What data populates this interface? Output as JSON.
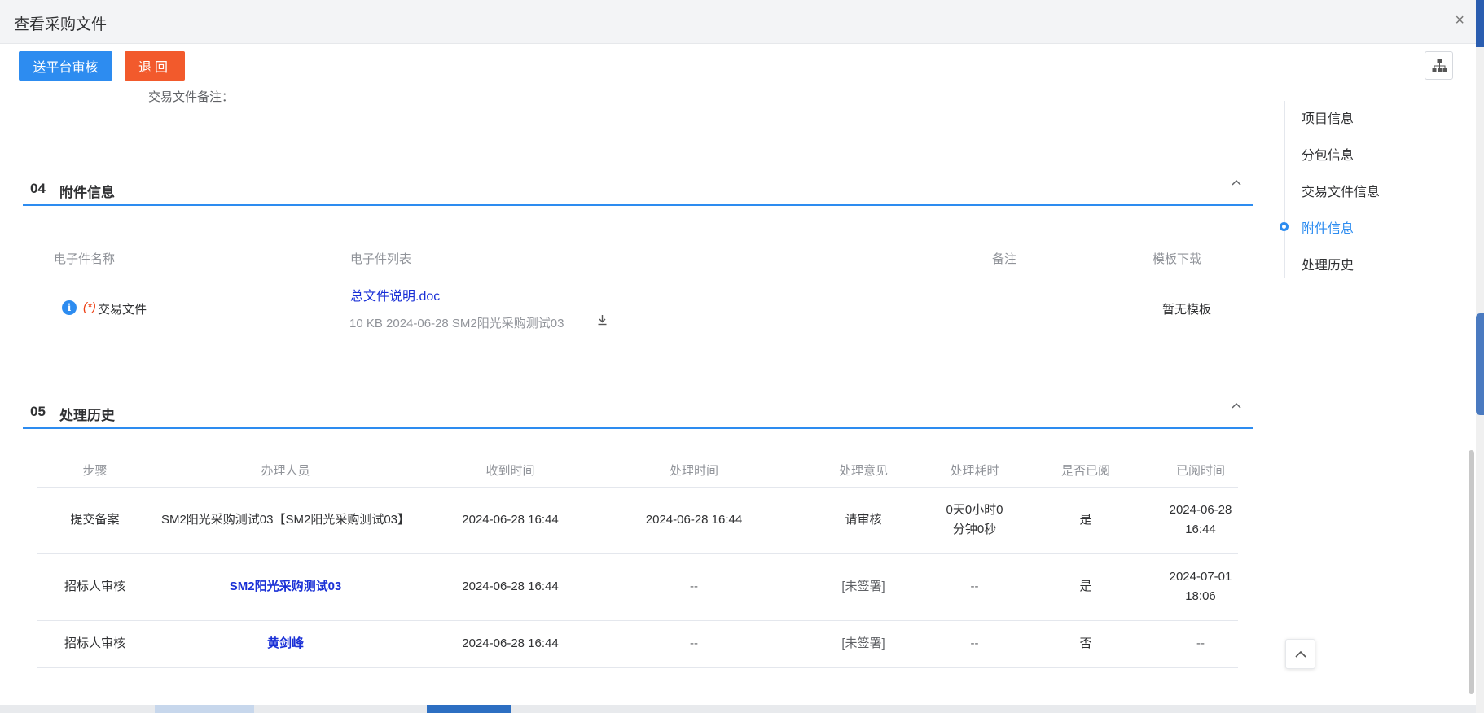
{
  "dialog": {
    "title": "查看采购文件",
    "close_glyph": "×"
  },
  "toolbar": {
    "submit_label": "送平台审核",
    "back_label": "退回"
  },
  "trade_doc": {
    "remark_label": "交易文件备注："
  },
  "attachments_section": {
    "number": "04",
    "title": "附件信息",
    "collapse_glyph": "^",
    "columns": [
      "电子件名称",
      "电子件列表",
      "备注",
      "模板下载"
    ],
    "rows": [
      {
        "required_mark": "(*)",
        "name": "交易文件",
        "file_name": "总文件说明.doc",
        "file_meta": "10 KB 2024-06-28 SM2阳光采购测试03",
        "remark": "",
        "template": "暂无模板"
      }
    ]
  },
  "history_section": {
    "number": "05",
    "title": "处理历史",
    "collapse_glyph": "^",
    "columns": [
      "步骤",
      "办理人员",
      "收到时间",
      "处理时间",
      "处理意见",
      "处理耗时",
      "是否已阅",
      "已阅时间"
    ],
    "rows": [
      {
        "step": "提交备案",
        "handler": "SM2阳光采购测试03【SM2阳光采购测试03】",
        "received": "2024-06-28 16:44",
        "processed": "2024-06-28 16:44",
        "opinion": "请审核",
        "duration": "0天0小时0分钟0秒",
        "read": "是",
        "read_time": "2024-06-28 16:44"
      },
      {
        "step": "招标人审核",
        "handler": "SM2阳光采购测试03",
        "received": "2024-06-28 16:44",
        "processed": "--",
        "opinion": "[未签署]",
        "duration": "--",
        "read": "是",
        "read_time": "2024-07-01 18:06"
      },
      {
        "step": "招标人审核",
        "handler": "黄剑峰",
        "received": "2024-06-28 16:44",
        "processed": "--",
        "opinion": "[未签署]",
        "duration": "--",
        "read": "否",
        "read_time": "--"
      }
    ]
  },
  "anchor_nav": {
    "items": [
      "项目信息",
      "分包信息",
      "交易文件信息",
      "附件信息",
      "处理历史"
    ],
    "active": "附件信息"
  },
  "icons": {
    "info": "info-icon",
    "download": "download-icon",
    "tree": "org-tree-icon",
    "back_to_top": "chevron-up-icon"
  },
  "colors": {
    "primary": "#2d8cf0",
    "danger": "#f25a2c",
    "link": "#1a30d6",
    "required": "#ed4014"
  }
}
